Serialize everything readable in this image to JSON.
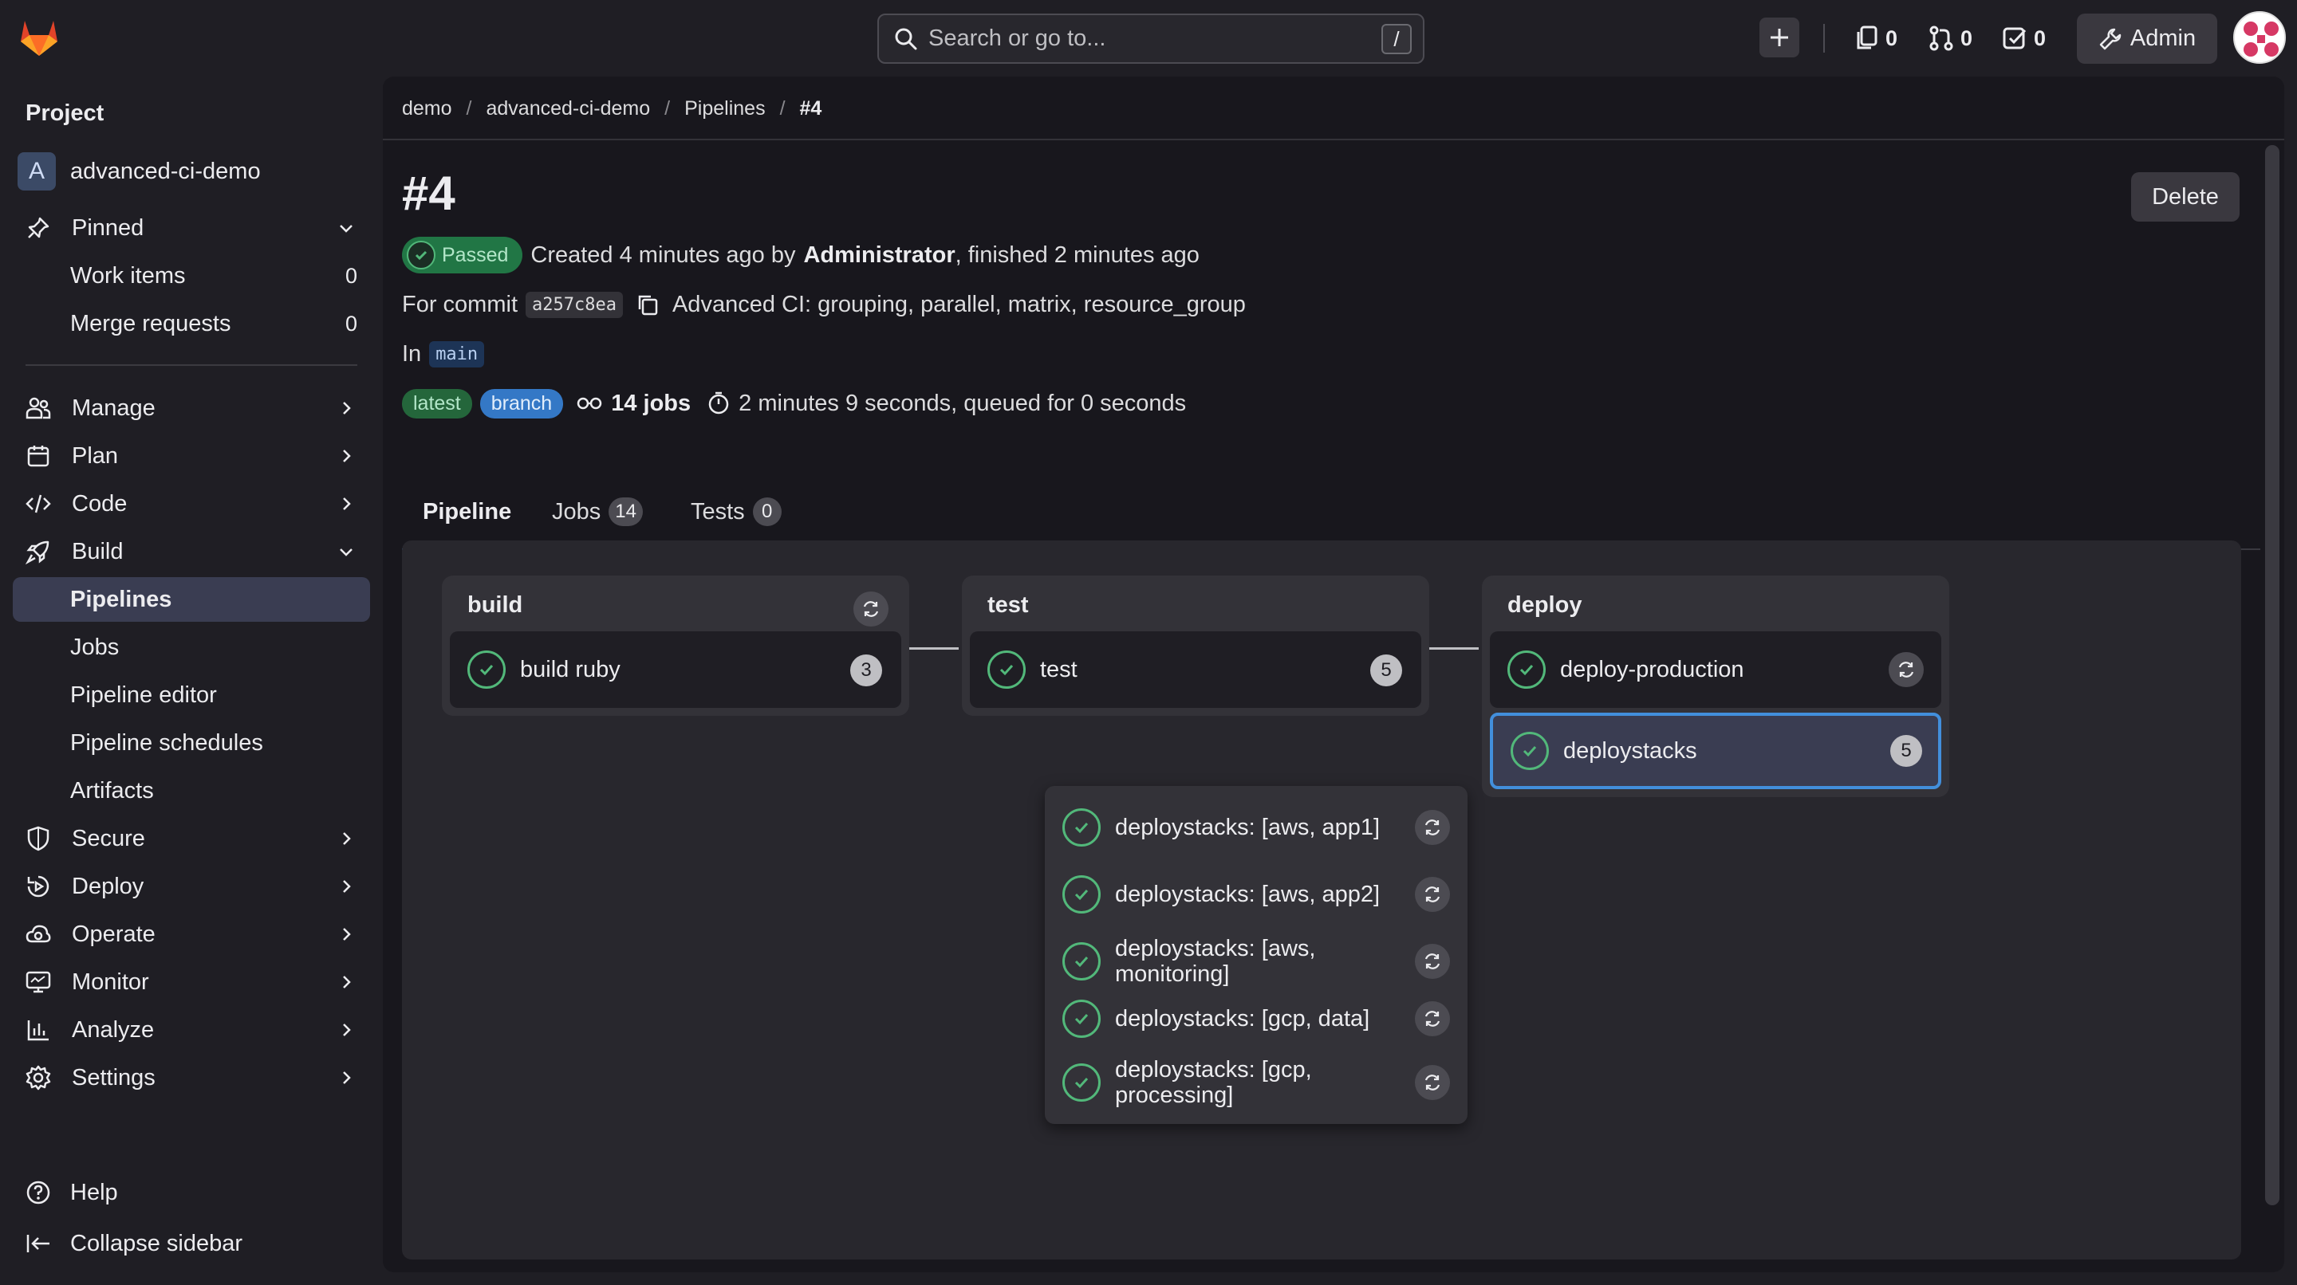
{
  "topbar": {
    "search_placeholder": "Search or go to...",
    "search_shortcut": "/",
    "issues_count": "0",
    "merge_requests_count": "0",
    "todos_count": "0",
    "admin_label": "Admin"
  },
  "sidebar": {
    "heading": "Project",
    "project_initial": "A",
    "project_name": "advanced-ci-demo",
    "pinned_label": "Pinned",
    "pinned_items": [
      {
        "label": "Work items",
        "count": "0"
      },
      {
        "label": "Merge requests",
        "count": "0"
      }
    ],
    "sections": [
      {
        "label": "Manage",
        "icon": "users-icon"
      },
      {
        "label": "Plan",
        "icon": "calendar-icon"
      },
      {
        "label": "Code",
        "icon": "code-icon"
      },
      {
        "label": "Build",
        "icon": "rocket-icon"
      }
    ],
    "build_items": [
      "Pipelines",
      "Jobs",
      "Pipeline editor",
      "Pipeline schedules",
      "Artifacts"
    ],
    "sections_after": [
      {
        "label": "Secure",
        "icon": "shield-icon"
      },
      {
        "label": "Deploy",
        "icon": "deploy-icon"
      },
      {
        "label": "Operate",
        "icon": "cloud-gear-icon"
      },
      {
        "label": "Monitor",
        "icon": "monitor-icon"
      },
      {
        "label": "Analyze",
        "icon": "chart-icon"
      },
      {
        "label": "Settings",
        "icon": "gear-icon"
      }
    ],
    "help_label": "Help",
    "collapse_label": "Collapse sidebar"
  },
  "breadcrumb": [
    "demo",
    "advanced-ci-demo",
    "Pipelines",
    "#4"
  ],
  "pipeline": {
    "title": "#4",
    "delete_label": "Delete",
    "status": "Passed",
    "created_prefix": "Created 4 minutes ago by",
    "author": "Administrator",
    "finished": ", finished 2 minutes ago",
    "for_commit_label": "For commit",
    "commit_sha": "a257c8ea",
    "commit_message": "Advanced CI: grouping, parallel, matrix, resource_group",
    "in_label": "In",
    "branch": "main",
    "badge_latest": "latest",
    "badge_branch": "branch",
    "jobs_count": "14 jobs",
    "duration": "2 minutes 9 seconds, queued for 0 seconds"
  },
  "tabs": [
    {
      "label": "Pipeline",
      "count": null
    },
    {
      "label": "Jobs",
      "count": "14"
    },
    {
      "label": "Tests",
      "count": "0"
    }
  ],
  "stages": [
    {
      "name": "build",
      "jobs": [
        {
          "name": "build ruby",
          "count": "3"
        }
      ]
    },
    {
      "name": "test",
      "jobs": [
        {
          "name": "test",
          "count": "5"
        }
      ]
    },
    {
      "name": "deploy",
      "jobs": [
        {
          "name": "deploy-production"
        },
        {
          "name": "deploystacks",
          "count": "5"
        }
      ]
    }
  ],
  "dropdown_jobs": [
    "deploystacks: [aws, app1]",
    "deploystacks: [aws, app2]",
    "deploystacks: [aws, monitoring]",
    "deploystacks: [gcp, data]",
    "deploystacks: [gcp, processing]"
  ],
  "colors": {
    "success": "#52b87a",
    "accent": "#428fdc",
    "brand_orange": "#e24329"
  }
}
